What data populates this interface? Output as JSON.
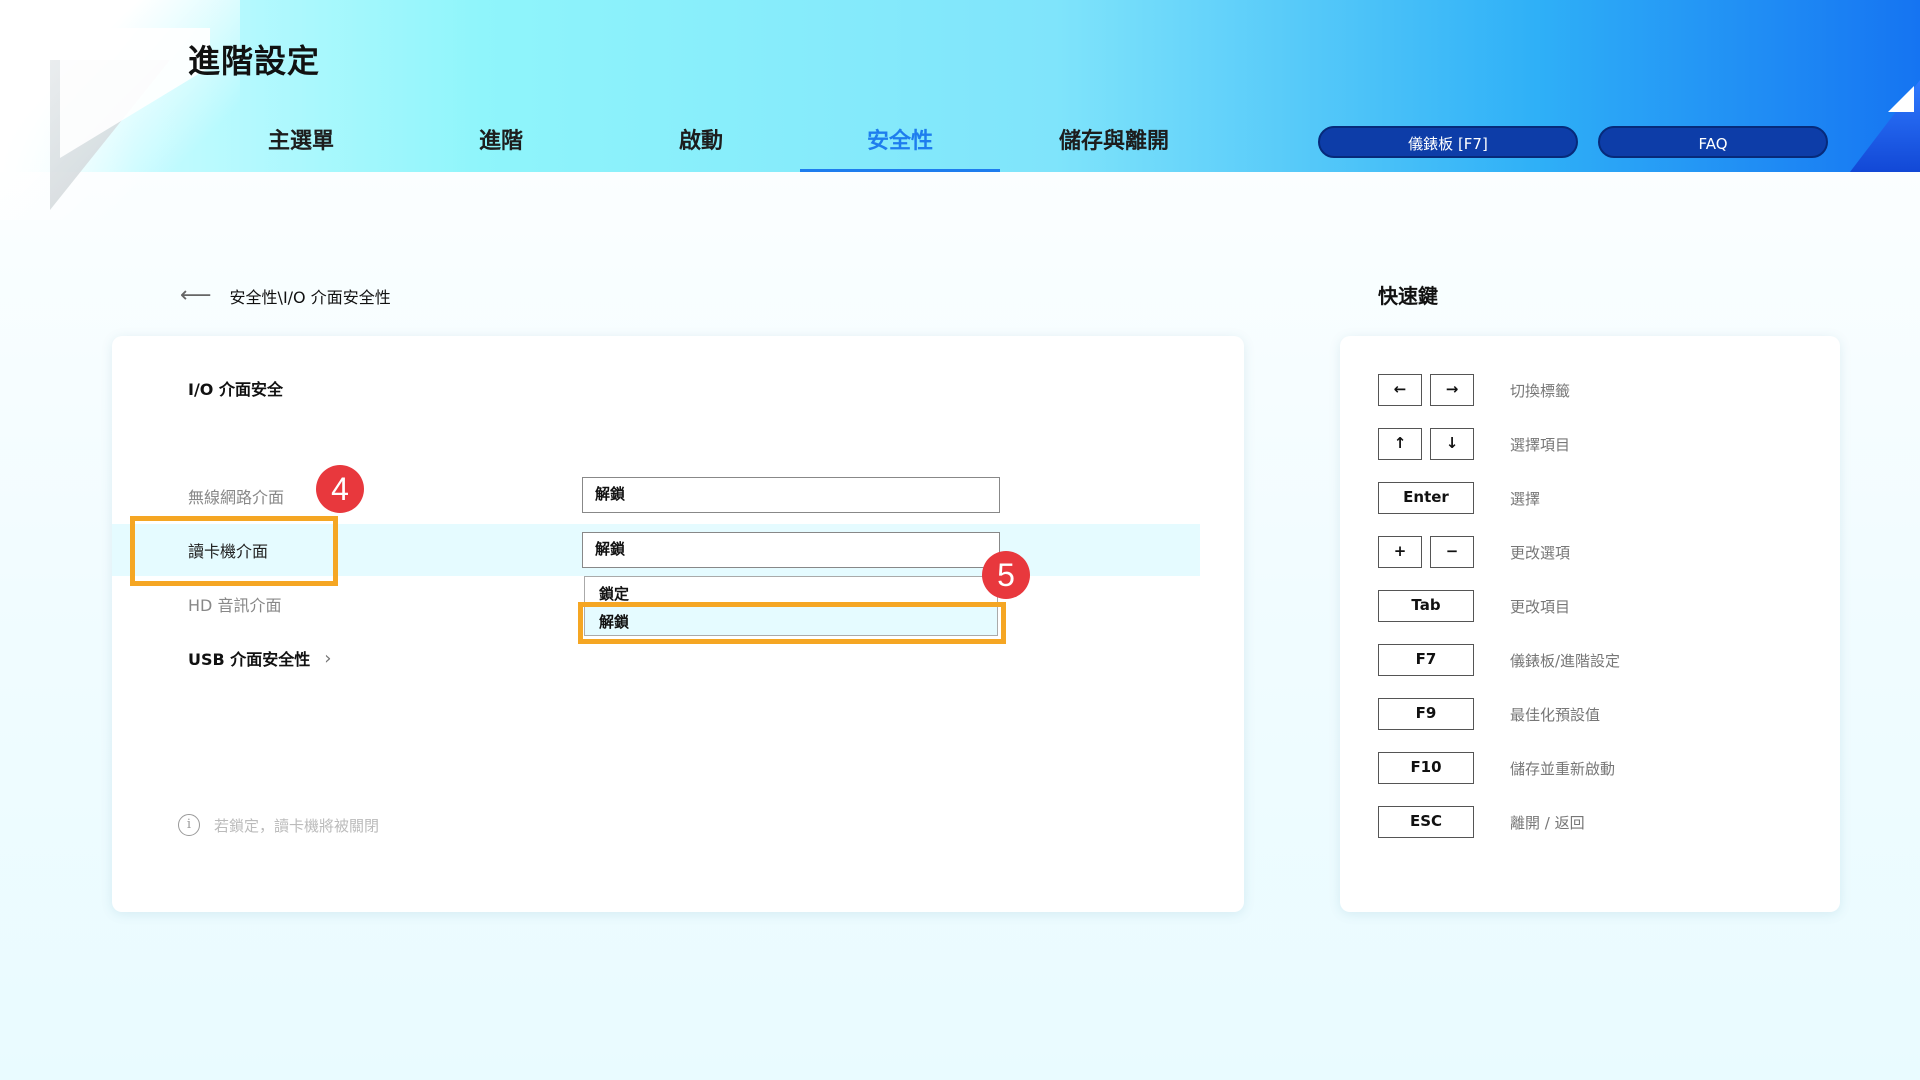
{
  "header": {
    "title": "進階設定",
    "tabs": [
      {
        "label": "主選單",
        "active": false
      },
      {
        "label": "進階",
        "active": false
      },
      {
        "label": "啟動",
        "active": false
      },
      {
        "label": "安全性",
        "active": true
      },
      {
        "label": "儲存與離開",
        "active": false
      }
    ],
    "dashboard_button": "儀錶板 [F7]",
    "faq_button": "FAQ"
  },
  "breadcrumb": "安全性\\I/O 介面安全性",
  "main": {
    "section_title": "I/O 介面安全",
    "rows": [
      {
        "label": "無線網路介面",
        "value": "解鎖"
      },
      {
        "label": "讀卡機介面",
        "value": "解鎖"
      },
      {
        "label": "HD 音訊介面"
      },
      {
        "label": "USB 介面安全性"
      }
    ],
    "dropdown_options": [
      "鎖定",
      "解鎖"
    ],
    "info_text": "若鎖定，讀卡機將被關閉"
  },
  "annotations": {
    "badge_4": "4",
    "badge_5": "5"
  },
  "hotkeys": {
    "title": "快速鍵",
    "items": [
      {
        "keys": [
          "←",
          "→"
        ],
        "desc": "切換標籤"
      },
      {
        "keys": [
          "↑",
          "↓"
        ],
        "desc": "選擇項目"
      },
      {
        "keys": [
          "Enter"
        ],
        "desc": "選擇"
      },
      {
        "keys": [
          "+",
          "−"
        ],
        "desc": "更改選項"
      },
      {
        "keys": [
          "Tab"
        ],
        "desc": "更改項目"
      },
      {
        "keys": [
          "F7"
        ],
        "desc": "儀錶板/進階設定"
      },
      {
        "keys": [
          "F9"
        ],
        "desc": "最佳化預設值"
      },
      {
        "keys": [
          "F10"
        ],
        "desc": "儲存並重新啟動"
      },
      {
        "keys": [
          "ESC"
        ],
        "desc": "離開 / 返回"
      }
    ]
  },
  "colors": {
    "accent": "#1e7dee",
    "pill": "#0d3da8",
    "highlight": "#f5a623",
    "badge": "#e8383d"
  }
}
